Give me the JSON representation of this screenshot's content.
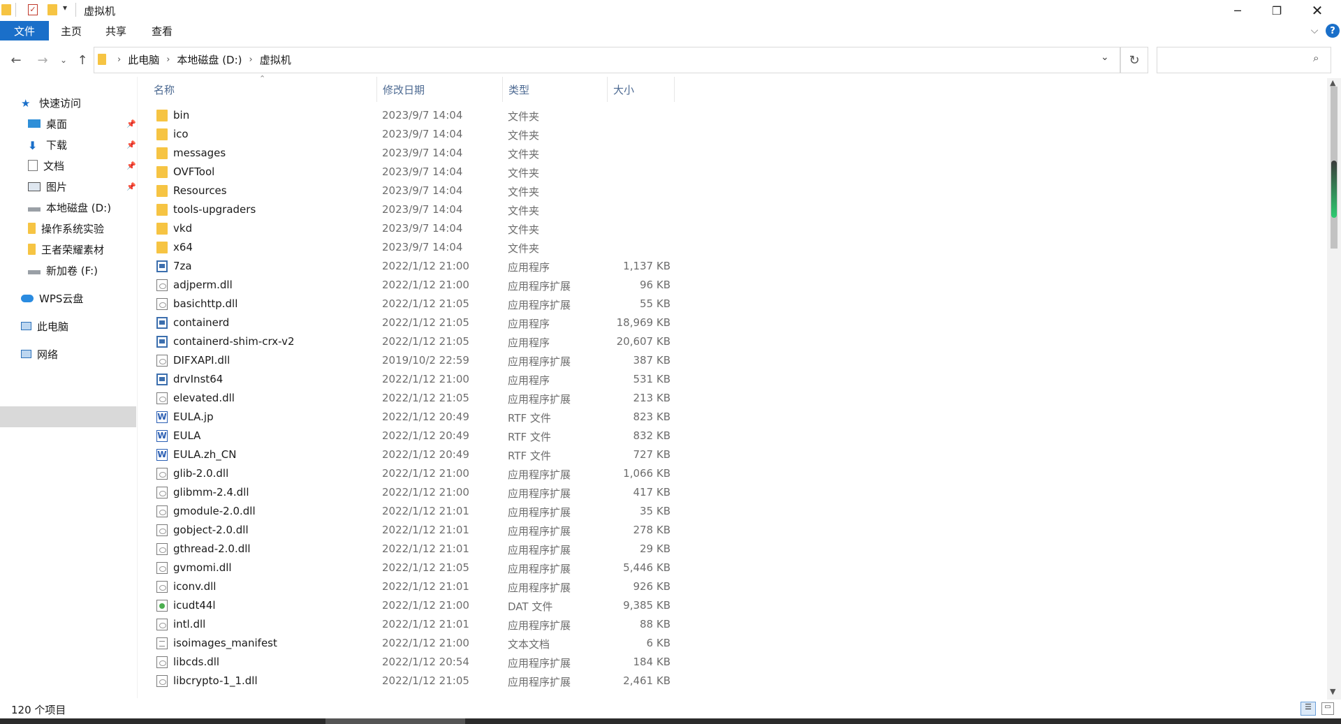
{
  "window": {
    "title": "虚拟机"
  },
  "ribbon": {
    "tabs": [
      "文件",
      "主页",
      "共享",
      "查看"
    ]
  },
  "address": {
    "crumbs": [
      "此电脑",
      "本地磁盘 (D:)",
      "虚拟机"
    ]
  },
  "sidebar": {
    "items": [
      {
        "label": "快速访问",
        "icon": "star-icon"
      },
      {
        "label": "桌面",
        "icon": "desktop-icon",
        "pinned": true
      },
      {
        "label": "下载",
        "icon": "download-icon",
        "pinned": true
      },
      {
        "label": "文档",
        "icon": "document-icon",
        "pinned": true
      },
      {
        "label": "图片",
        "icon": "picture-icon",
        "pinned": true
      },
      {
        "label": "本地磁盘 (D:)",
        "icon": "drive-icon"
      },
      {
        "label": "操作系统实验",
        "icon": "folder-icon"
      },
      {
        "label": "王者荣耀素材",
        "icon": "folder-icon"
      },
      {
        "label": "新加卷 (F:)",
        "icon": "drive-icon"
      },
      {
        "label": "WPS云盘",
        "icon": "cloud-icon"
      },
      {
        "label": "此电脑",
        "icon": "computer-icon",
        "selected": true
      },
      {
        "label": "网络",
        "icon": "network-icon"
      }
    ]
  },
  "columns": {
    "name": "名称",
    "date": "修改日期",
    "type": "类型",
    "size": "大小"
  },
  "files": [
    {
      "name": "bin",
      "date": "2023/9/7 14:04",
      "type": "文件夹",
      "size": "",
      "icon": "folder"
    },
    {
      "name": "ico",
      "date": "2023/9/7 14:04",
      "type": "文件夹",
      "size": "",
      "icon": "folder"
    },
    {
      "name": "messages",
      "date": "2023/9/7 14:04",
      "type": "文件夹",
      "size": "",
      "icon": "folder"
    },
    {
      "name": "OVFTool",
      "date": "2023/9/7 14:04",
      "type": "文件夹",
      "size": "",
      "icon": "folder"
    },
    {
      "name": "Resources",
      "date": "2023/9/7 14:04",
      "type": "文件夹",
      "size": "",
      "icon": "folder"
    },
    {
      "name": "tools-upgraders",
      "date": "2023/9/7 14:04",
      "type": "文件夹",
      "size": "",
      "icon": "folder"
    },
    {
      "name": "vkd",
      "date": "2023/9/7 14:04",
      "type": "文件夹",
      "size": "",
      "icon": "folder"
    },
    {
      "name": "x64",
      "date": "2023/9/7 14:04",
      "type": "文件夹",
      "size": "",
      "icon": "folder"
    },
    {
      "name": "7za",
      "date": "2022/1/12 21:00",
      "type": "应用程序",
      "size": "1,137 KB",
      "icon": "app"
    },
    {
      "name": "adjperm.dll",
      "date": "2022/1/12 21:00",
      "type": "应用程序扩展",
      "size": "96 KB",
      "icon": "dll"
    },
    {
      "name": "basichttp.dll",
      "date": "2022/1/12 21:05",
      "type": "应用程序扩展",
      "size": "55 KB",
      "icon": "dll"
    },
    {
      "name": "containerd",
      "date": "2022/1/12 21:05",
      "type": "应用程序",
      "size": "18,969 KB",
      "icon": "app"
    },
    {
      "name": "containerd-shim-crx-v2",
      "date": "2022/1/12 21:05",
      "type": "应用程序",
      "size": "20,607 KB",
      "icon": "app"
    },
    {
      "name": "DIFXAPI.dll",
      "date": "2019/10/2 22:59",
      "type": "应用程序扩展",
      "size": "387 KB",
      "icon": "dll"
    },
    {
      "name": "drvInst64",
      "date": "2022/1/12 21:00",
      "type": "应用程序",
      "size": "531 KB",
      "icon": "app"
    },
    {
      "name": "elevated.dll",
      "date": "2022/1/12 21:05",
      "type": "应用程序扩展",
      "size": "213 KB",
      "icon": "dll"
    },
    {
      "name": "EULA.jp",
      "date": "2022/1/12 20:49",
      "type": "RTF 文件",
      "size": "823 KB",
      "icon": "word"
    },
    {
      "name": "EULA",
      "date": "2022/1/12 20:49",
      "type": "RTF 文件",
      "size": "832 KB",
      "icon": "word"
    },
    {
      "name": "EULA.zh_CN",
      "date": "2022/1/12 20:49",
      "type": "RTF 文件",
      "size": "727 KB",
      "icon": "word"
    },
    {
      "name": "glib-2.0.dll",
      "date": "2022/1/12 21:00",
      "type": "应用程序扩展",
      "size": "1,066 KB",
      "icon": "dll"
    },
    {
      "name": "glibmm-2.4.dll",
      "date": "2022/1/12 21:00",
      "type": "应用程序扩展",
      "size": "417 KB",
      "icon": "dll"
    },
    {
      "name": "gmodule-2.0.dll",
      "date": "2022/1/12 21:01",
      "type": "应用程序扩展",
      "size": "35 KB",
      "icon": "dll"
    },
    {
      "name": "gobject-2.0.dll",
      "date": "2022/1/12 21:01",
      "type": "应用程序扩展",
      "size": "278 KB",
      "icon": "dll"
    },
    {
      "name": "gthread-2.0.dll",
      "date": "2022/1/12 21:01",
      "type": "应用程序扩展",
      "size": "29 KB",
      "icon": "dll"
    },
    {
      "name": "gvmomi.dll",
      "date": "2022/1/12 21:05",
      "type": "应用程序扩展",
      "size": "5,446 KB",
      "icon": "dll"
    },
    {
      "name": "iconv.dll",
      "date": "2022/1/12 21:01",
      "type": "应用程序扩展",
      "size": "926 KB",
      "icon": "dll"
    },
    {
      "name": "icudt44l",
      "date": "2022/1/12 21:00",
      "type": "DAT 文件",
      "size": "9,385 KB",
      "icon": "dat"
    },
    {
      "name": "intl.dll",
      "date": "2022/1/12 21:01",
      "type": "应用程序扩展",
      "size": "88 KB",
      "icon": "dll"
    },
    {
      "name": "isoimages_manifest",
      "date": "2022/1/12 21:00",
      "type": "文本文档",
      "size": "6 KB",
      "icon": "txt"
    },
    {
      "name": "libcds.dll",
      "date": "2022/1/12 20:54",
      "type": "应用程序扩展",
      "size": "184 KB",
      "icon": "dll"
    },
    {
      "name": "libcrypto-1_1.dll",
      "date": "2022/1/12 21:05",
      "type": "应用程序扩展",
      "size": "2,461 KB",
      "icon": "dll"
    }
  ],
  "status": {
    "item_count": "120 个项目"
  },
  "colors": {
    "file_tab": "#1a6fc9",
    "folder": "#f6c443",
    "column_header": "#4d6a92"
  }
}
